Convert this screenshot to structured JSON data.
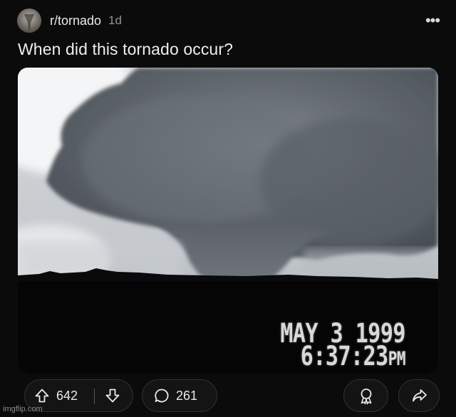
{
  "post": {
    "subreddit": "r/tornado",
    "age": "1d",
    "title": "When did this tornado occur?",
    "more_label": "•••",
    "image": {
      "timestamp_date": "MAY  3 1999",
      "timestamp_time": "6:37:23",
      "timestamp_suffix": "PM"
    }
  },
  "actions": {
    "upvotes": "642",
    "comments": "261"
  },
  "watermark": "imgflip.com",
  "icons": {
    "upvote": "upvote-arrow-icon",
    "downvote": "downvote-arrow-icon",
    "comment": "comment-bubble-icon",
    "award": "award-icon",
    "share": "share-arrow-icon",
    "more": "more-dots-icon"
  },
  "colors": {
    "background": "#0b0b0b",
    "text": "#e8eaed",
    "muted": "#8f949a",
    "pill_border": "#2e3033"
  }
}
